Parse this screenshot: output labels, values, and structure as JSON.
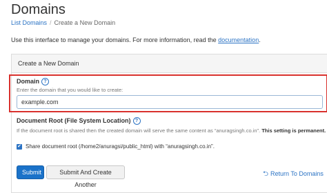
{
  "page": {
    "title": "Domains"
  },
  "breadcrumb": {
    "parent": "List Domains",
    "separator": "/",
    "current": "Create a New Domain"
  },
  "intro": {
    "text": "Use this interface to manage your domains. For more information, read the ",
    "link": "documentation",
    "suffix": "."
  },
  "panel": {
    "heading": "Create a New Domain"
  },
  "domain_field": {
    "label": "Domain",
    "help_icon": "question-circle-icon",
    "hint": "Enter the domain that you would like to create:",
    "value": "example.com"
  },
  "docroot_field": {
    "label": "Document Root (File System Location)",
    "help_icon": "question-circle-icon",
    "hint": "If the document root is shared then the created domain will serve the same content as “anuragsingh.co.in”.",
    "hint_bold": "This setting is permanent.",
    "checkbox_label": "Share document root (/home2/anuragsi/public_html) with “anuragsingh.co.in”.",
    "checkbox_checked": true
  },
  "actions": {
    "submit": "Submit",
    "submit_another": "Submit And Create Another",
    "return_link": "Return To Domains",
    "return_icon": "return-arrow-icon"
  },
  "colors": {
    "link": "#2b73c4",
    "primary_button": "#1a72c9",
    "highlight_box": "#d9302c"
  }
}
